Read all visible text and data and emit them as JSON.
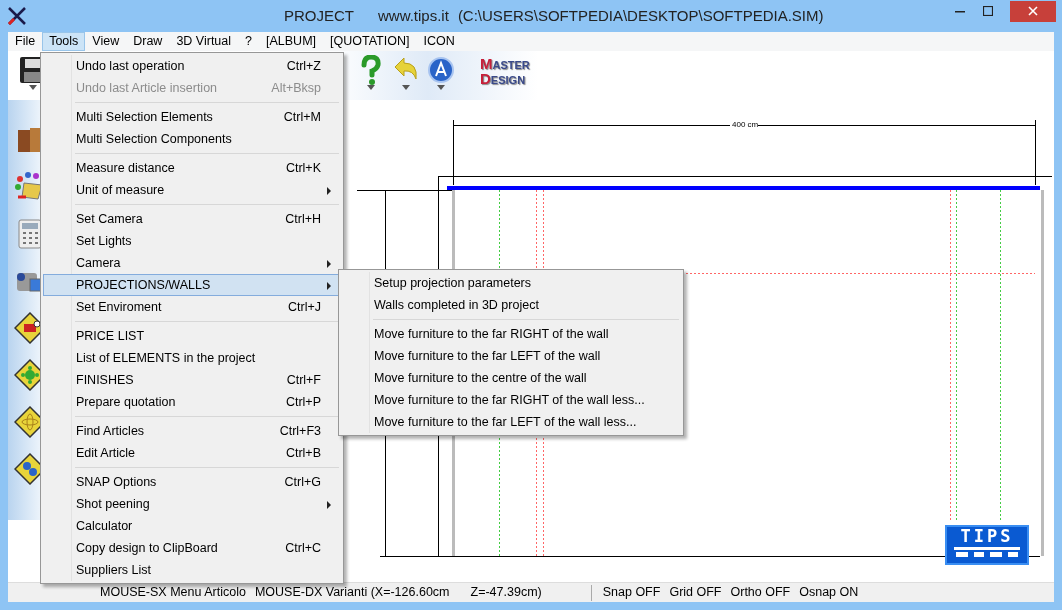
{
  "window": {
    "title": "PROJECT",
    "website": "www.tips.it",
    "path": "(C:\\USERS\\SOFTPEDIA\\DESKTOP\\SOFTPEDIA.SIM)"
  },
  "menu_bar": [
    {
      "label": "File",
      "selected": false
    },
    {
      "label": "Tools",
      "selected": true
    },
    {
      "label": "View",
      "selected": false
    },
    {
      "label": "Draw",
      "selected": false
    },
    {
      "label": "3D Virtual",
      "selected": false
    },
    {
      "label": "?",
      "selected": false
    },
    {
      "label": "[ALBUM]",
      "selected": false
    },
    {
      "label": "[QUOTATION]",
      "selected": false
    },
    {
      "label": "ICON",
      "selected": false
    }
  ],
  "tools_menu": {
    "groups": [
      [
        {
          "label": "Undo last operation",
          "shortcut": "Ctrl+Z",
          "disabled": false,
          "has_submenu": false,
          "selected": false
        },
        {
          "label": "Undo last Article insertion",
          "shortcut": "Alt+Bksp",
          "disabled": true,
          "has_submenu": false,
          "selected": false
        }
      ],
      [
        {
          "label": "Multi Selection Elements",
          "shortcut": "Ctrl+M",
          "disabled": false,
          "has_submenu": false,
          "selected": false
        },
        {
          "label": "Multi Selection Components",
          "disabled": false,
          "has_submenu": false,
          "selected": false
        }
      ],
      [
        {
          "label": "Measure distance",
          "shortcut": "Ctrl+K",
          "disabled": false,
          "has_submenu": false,
          "selected": false
        },
        {
          "label": "Unit of measure",
          "disabled": false,
          "has_submenu": true,
          "selected": false
        }
      ],
      [
        {
          "label": "Set Camera",
          "shortcut": "Ctrl+H",
          "disabled": false,
          "has_submenu": false,
          "selected": false
        },
        {
          "label": "Set Lights",
          "disabled": false,
          "has_submenu": false,
          "selected": false
        },
        {
          "label": "Camera",
          "disabled": false,
          "has_submenu": true,
          "selected": false
        },
        {
          "label": "PROJECTIONS/WALLS",
          "disabled": false,
          "has_submenu": true,
          "selected": true
        },
        {
          "label": "Set Enviroment",
          "shortcut": "Ctrl+J",
          "disabled": false,
          "has_submenu": false,
          "selected": false
        }
      ],
      [
        {
          "label": "PRICE LIST",
          "disabled": false,
          "has_submenu": false,
          "selected": false
        },
        {
          "label": "List of ELEMENTS in the project",
          "disabled": false,
          "has_submenu": false,
          "selected": false
        },
        {
          "label": "FINISHES",
          "shortcut": "Ctrl+F",
          "disabled": false,
          "has_submenu": false,
          "selected": false
        },
        {
          "label": "Prepare quotation",
          "shortcut": "Ctrl+P",
          "disabled": false,
          "has_submenu": false,
          "selected": false
        }
      ],
      [
        {
          "label": "Find Articles",
          "shortcut": "Ctrl+F3",
          "disabled": false,
          "has_submenu": false,
          "selected": false
        },
        {
          "label": "Edit Article",
          "shortcut": "Ctrl+B",
          "disabled": false,
          "has_submenu": false,
          "selected": false
        }
      ],
      [
        {
          "label": "SNAP Options",
          "shortcut": "Ctrl+G",
          "disabled": false,
          "has_submenu": false,
          "selected": false
        },
        {
          "label": "Shot peening",
          "disabled": false,
          "has_submenu": true,
          "selected": false
        },
        {
          "label": "Calculator",
          "disabled": false,
          "has_submenu": false,
          "selected": false
        },
        {
          "label": "Copy design to ClipBoard",
          "shortcut": "Ctrl+C",
          "disabled": false,
          "has_submenu": false,
          "selected": false
        },
        {
          "label": "Suppliers List",
          "disabled": false,
          "has_submenu": false,
          "selected": false
        }
      ]
    ]
  },
  "walls_submenu": {
    "groups": [
      [
        "Setup projection parameters",
        "Walls completed in 3D project"
      ],
      [
        "Move furniture to the far RIGHT of the wall",
        "Move furniture to the far LEFT of the wall",
        "Move furniture to the centre of the wall",
        "Move furniture to the far RIGHT of the wall less...",
        "Move furniture to the far LEFT of the wall less..."
      ]
    ]
  },
  "toolbar_logo": {
    "line_1": "MASTER",
    "line_2": "DESIGN"
  },
  "drawing": {
    "dimension": "400 cm",
    "corner_logo": "TIPS"
  },
  "status_bar": {
    "left_hint": "MOUSE-SX Menu Articolo",
    "right_hint": "MOUSE-DX Varianti (X=-126.60cm",
    "z_coord": "Z=-47.39cm)",
    "toggles": [
      "Snap OFF",
      "Grid OFF",
      "Ortho OFF",
      "Osnap ON"
    ]
  }
}
